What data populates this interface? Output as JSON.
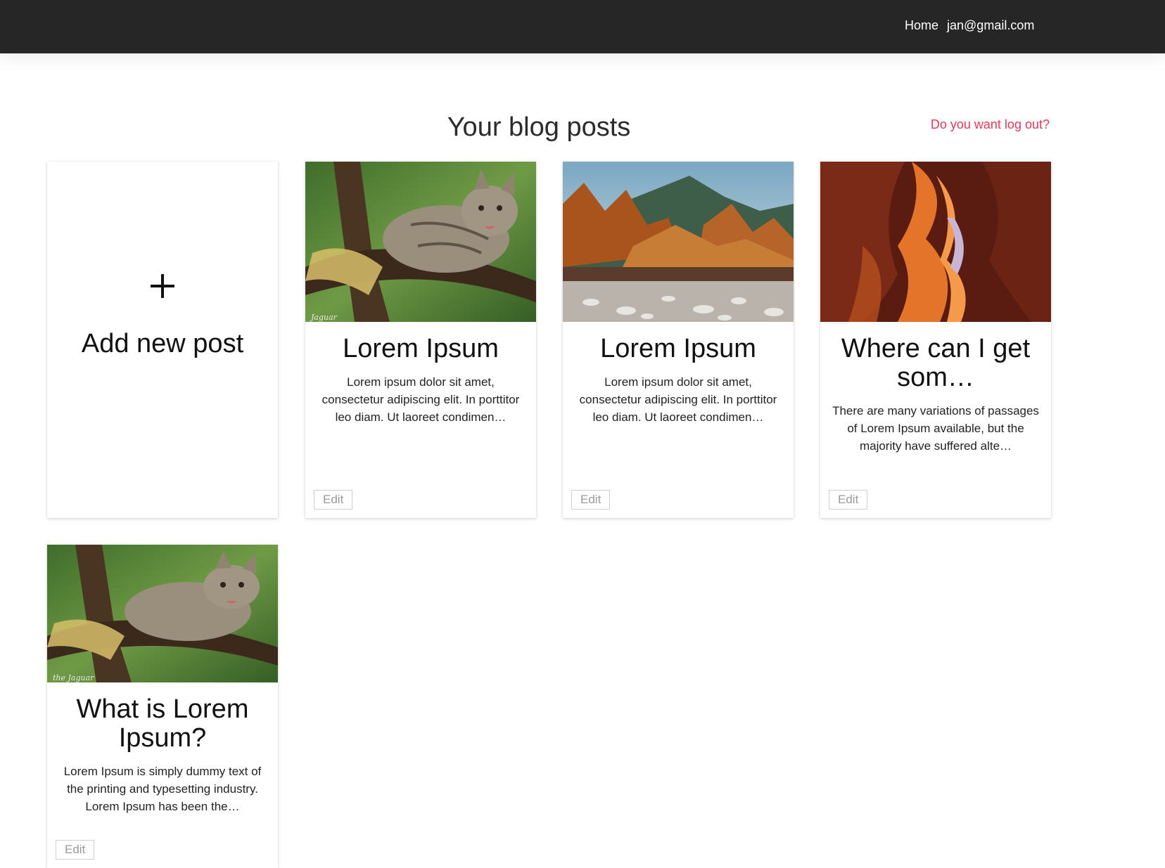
{
  "nav": {
    "home_label": "Home",
    "user_email": "jan@gmail.com"
  },
  "page": {
    "title": "Your blog posts",
    "logout_label": "Do you want log out?"
  },
  "add_card": {
    "label": "Add new post"
  },
  "posts": [
    {
      "title": "Lorem Ipsum",
      "excerpt": "Lorem ipsum dolor sit amet, consectetur adipiscing elit. In porttitor leo diam. Ut laoreet condimen…",
      "edit_label": "Edit",
      "image": "cat-photo",
      "watermark": "Jaguar"
    },
    {
      "title": "Lorem Ipsum",
      "excerpt": "Lorem ipsum dolor sit amet, consectetur adipiscing elit. In porttitor leo diam. Ut laoreet condimen…",
      "edit_label": "Edit",
      "image": "mountain-river-photo"
    },
    {
      "title": "Where can I get som…",
      "excerpt": "There are many variations of passages of Lorem Ipsum available, but the majority have suffered alte…",
      "edit_label": "Edit",
      "image": "canyon-photo"
    },
    {
      "title": "What is Lorem Ipsum?",
      "excerpt": "Lorem Ipsum is simply dummy text of the printing and typesetting industry. Lorem Ipsum has been the…",
      "edit_label": "Edit",
      "image": "cat-photo",
      "watermark": "the Jaguar"
    }
  ],
  "colors": {
    "navbar": "#262626",
    "logout_link": "#e03a55"
  }
}
